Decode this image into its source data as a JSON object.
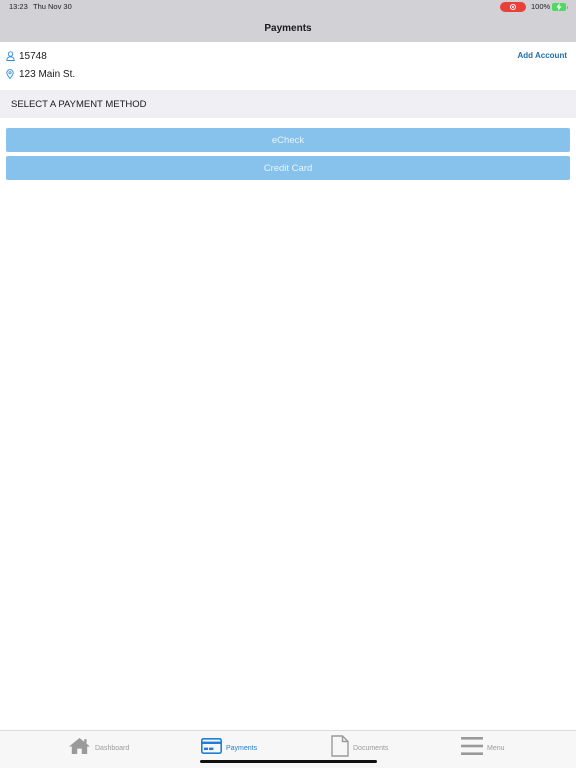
{
  "status_bar": {
    "time": "13:23",
    "date": "Thu Nov 30",
    "battery_percent": "100%",
    "recording_color": "#e8403a",
    "battery_color": "#4cd964"
  },
  "nav": {
    "title": "Payments"
  },
  "account": {
    "number": "15748",
    "address": "123 Main St.",
    "add_account_label": "Add Account",
    "person_icon": "person-icon",
    "location_icon": "location-pin-icon"
  },
  "section": {
    "header": "SELECT A PAYMENT METHOD"
  },
  "payment_methods": [
    {
      "label": "eCheck"
    },
    {
      "label": "Credit Card"
    }
  ],
  "tabs": [
    {
      "label": "Dashboard",
      "icon": "home-icon",
      "active": false
    },
    {
      "label": "Payments",
      "icon": "credit-card-icon",
      "active": true
    },
    {
      "label": "Documents",
      "icon": "document-icon",
      "active": false
    },
    {
      "label": "Menu",
      "icon": "hamburger-menu-icon",
      "active": false
    }
  ],
  "colors": {
    "accent": "#1e7fd6",
    "button_fill": "#86c2ec",
    "link": "#1e6fa8",
    "bar_gray": "#d1d1d6",
    "section_bg": "#efeff4"
  }
}
